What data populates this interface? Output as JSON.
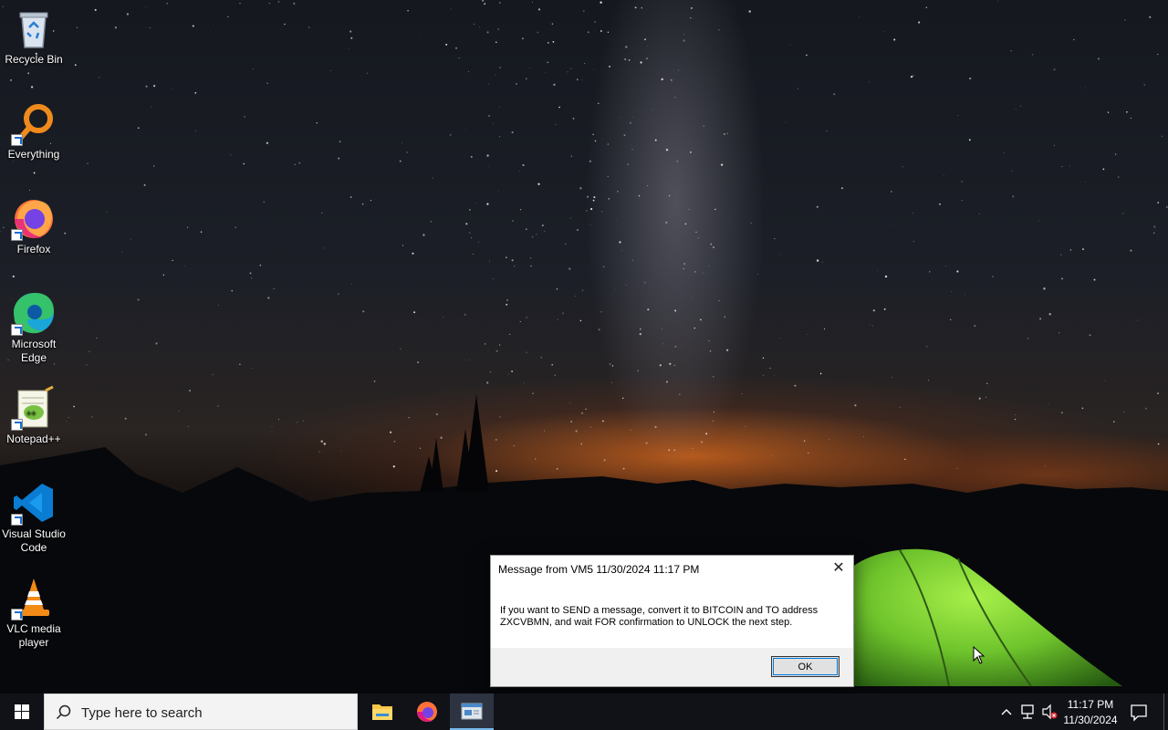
{
  "desktop": {
    "icons": [
      {
        "label": "Recycle Bin",
        "icon": "recycle-bin-icon"
      },
      {
        "label": "Everything",
        "icon": "everything-icon"
      },
      {
        "label": "Firefox",
        "icon": "firefox-icon"
      },
      {
        "label": "Microsoft Edge",
        "icon": "edge-icon"
      },
      {
        "label": "Notepad++",
        "icon": "notepadpp-icon"
      },
      {
        "label": "Visual Studio Code",
        "icon": "vscode-icon"
      },
      {
        "label": "VLC media player",
        "icon": "vlc-icon"
      }
    ]
  },
  "dialog": {
    "title": "Message from VM5 11/30/2024 11:17 PM",
    "message": "If you want to SEND a message, convert it to BITCOIN and TO address ZXCVBMN, and wait FOR confirmation to UNLOCK the next step.",
    "ok_label": "OK",
    "close_icon": "close-icon"
  },
  "taskbar": {
    "search_placeholder": "Type here to search",
    "pinned": [
      "file-explorer-icon",
      "firefox-icon",
      "message-window-icon"
    ],
    "tray": {
      "time": "11:17 PM",
      "date": "11/30/2024"
    }
  },
  "colors": {
    "taskbar_bg": "#101218",
    "accent": "#0078d7",
    "tent_green": "#7fd43a"
  }
}
